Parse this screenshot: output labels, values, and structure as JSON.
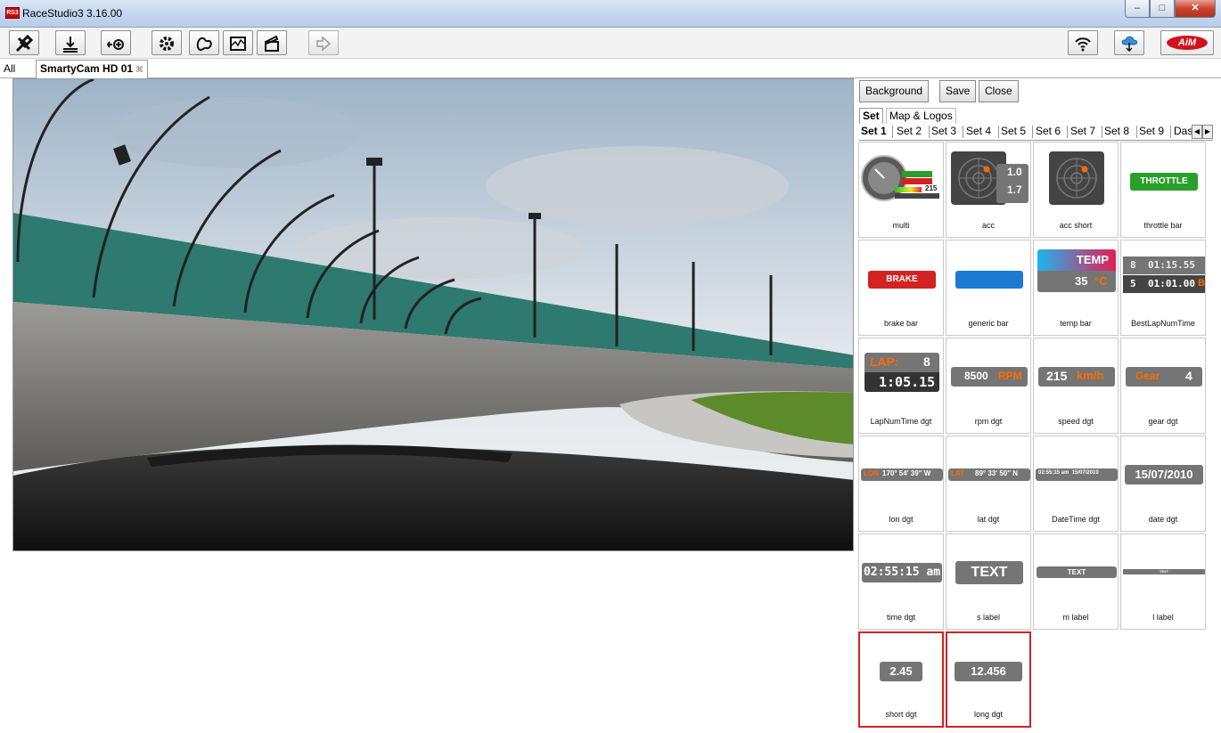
{
  "window": {
    "title": "RaceStudio3 3.16.00",
    "app_icon": "RS3"
  },
  "colors": {
    "brand": "#d0121b",
    "accent_orange": "#ff6a00",
    "widget_grey": "#757575",
    "selected_border": "#d32222"
  },
  "toolbar": {
    "icons": [
      "tools-icon",
      "ground-icon",
      "add-device-icon",
      "gear-icon",
      "track-icon",
      "analysis-icon",
      "video-icon",
      "export-icon"
    ],
    "right_icons": [
      "wifi-icon",
      "cloud-download-icon",
      "aim-logo"
    ],
    "aim_text": "AiM"
  },
  "doc_tabs": {
    "all_label": "All",
    "active_label": "SmartyCam HD 01",
    "close_glyph": "⌘"
  },
  "panel": {
    "buttons": {
      "background": "Background",
      "save": "Save",
      "close": "Close"
    },
    "tabs": [
      "Set",
      "Map & Logos"
    ],
    "set_tabs": [
      "Set 1",
      "Set 2",
      "Set 3",
      "Set 4",
      "Set 5",
      "Set 6",
      "Set 7",
      "Set 8",
      "Set 9",
      "Dasl"
    ]
  },
  "widgets": [
    {
      "label": "multi",
      "texts": [
        "215"
      ]
    },
    {
      "label": "acc",
      "texts": [
        "1.0",
        "1.7"
      ]
    },
    {
      "label": "acc short",
      "texts": []
    },
    {
      "label": "throttle bar",
      "texts": [
        "THROTTLE"
      ]
    },
    {
      "label": "brake bar",
      "texts": [
        "BRAKE"
      ]
    },
    {
      "label": "generic bar",
      "texts": []
    },
    {
      "label": "temp bar",
      "texts": [
        "TEMP",
        "35",
        "°C"
      ]
    },
    {
      "label": "BestLapNumTime",
      "texts": [
        "8",
        "01:15.55",
        "5",
        "01:01.00",
        "B"
      ]
    },
    {
      "label": "LapNumTime dgt",
      "texts": [
        "LAP:",
        "8",
        "1:05.15"
      ]
    },
    {
      "label": "rpm dgt",
      "texts": [
        "8500",
        "RPM"
      ]
    },
    {
      "label": "speed dgt",
      "texts": [
        "215",
        "km/h"
      ]
    },
    {
      "label": "gear dgt",
      "texts": [
        "Gear",
        "4"
      ]
    },
    {
      "label": "lon dgt",
      "texts": [
        "LON",
        "170° 54' 39'' W"
      ]
    },
    {
      "label": "lat dgt",
      "texts": [
        "LAT",
        "89° 33' 50'' N"
      ]
    },
    {
      "label": "DateTime dgt",
      "texts": [
        "02:55:15 am  15/07/2010"
      ]
    },
    {
      "label": "date dgt",
      "texts": [
        "15/07/2010"
      ]
    },
    {
      "label": "time dgt",
      "texts": [
        "02:55:15 am"
      ]
    },
    {
      "label": "s label",
      "texts": [
        "TEXT"
      ]
    },
    {
      "label": "m label",
      "texts": [
        "TEXT"
      ]
    },
    {
      "label": "l label",
      "texts": [
        "TEXT"
      ]
    },
    {
      "label": "short dgt",
      "texts": [
        "2.45"
      ]
    },
    {
      "label": "long dgt",
      "texts": [
        "12.456"
      ]
    }
  ]
}
